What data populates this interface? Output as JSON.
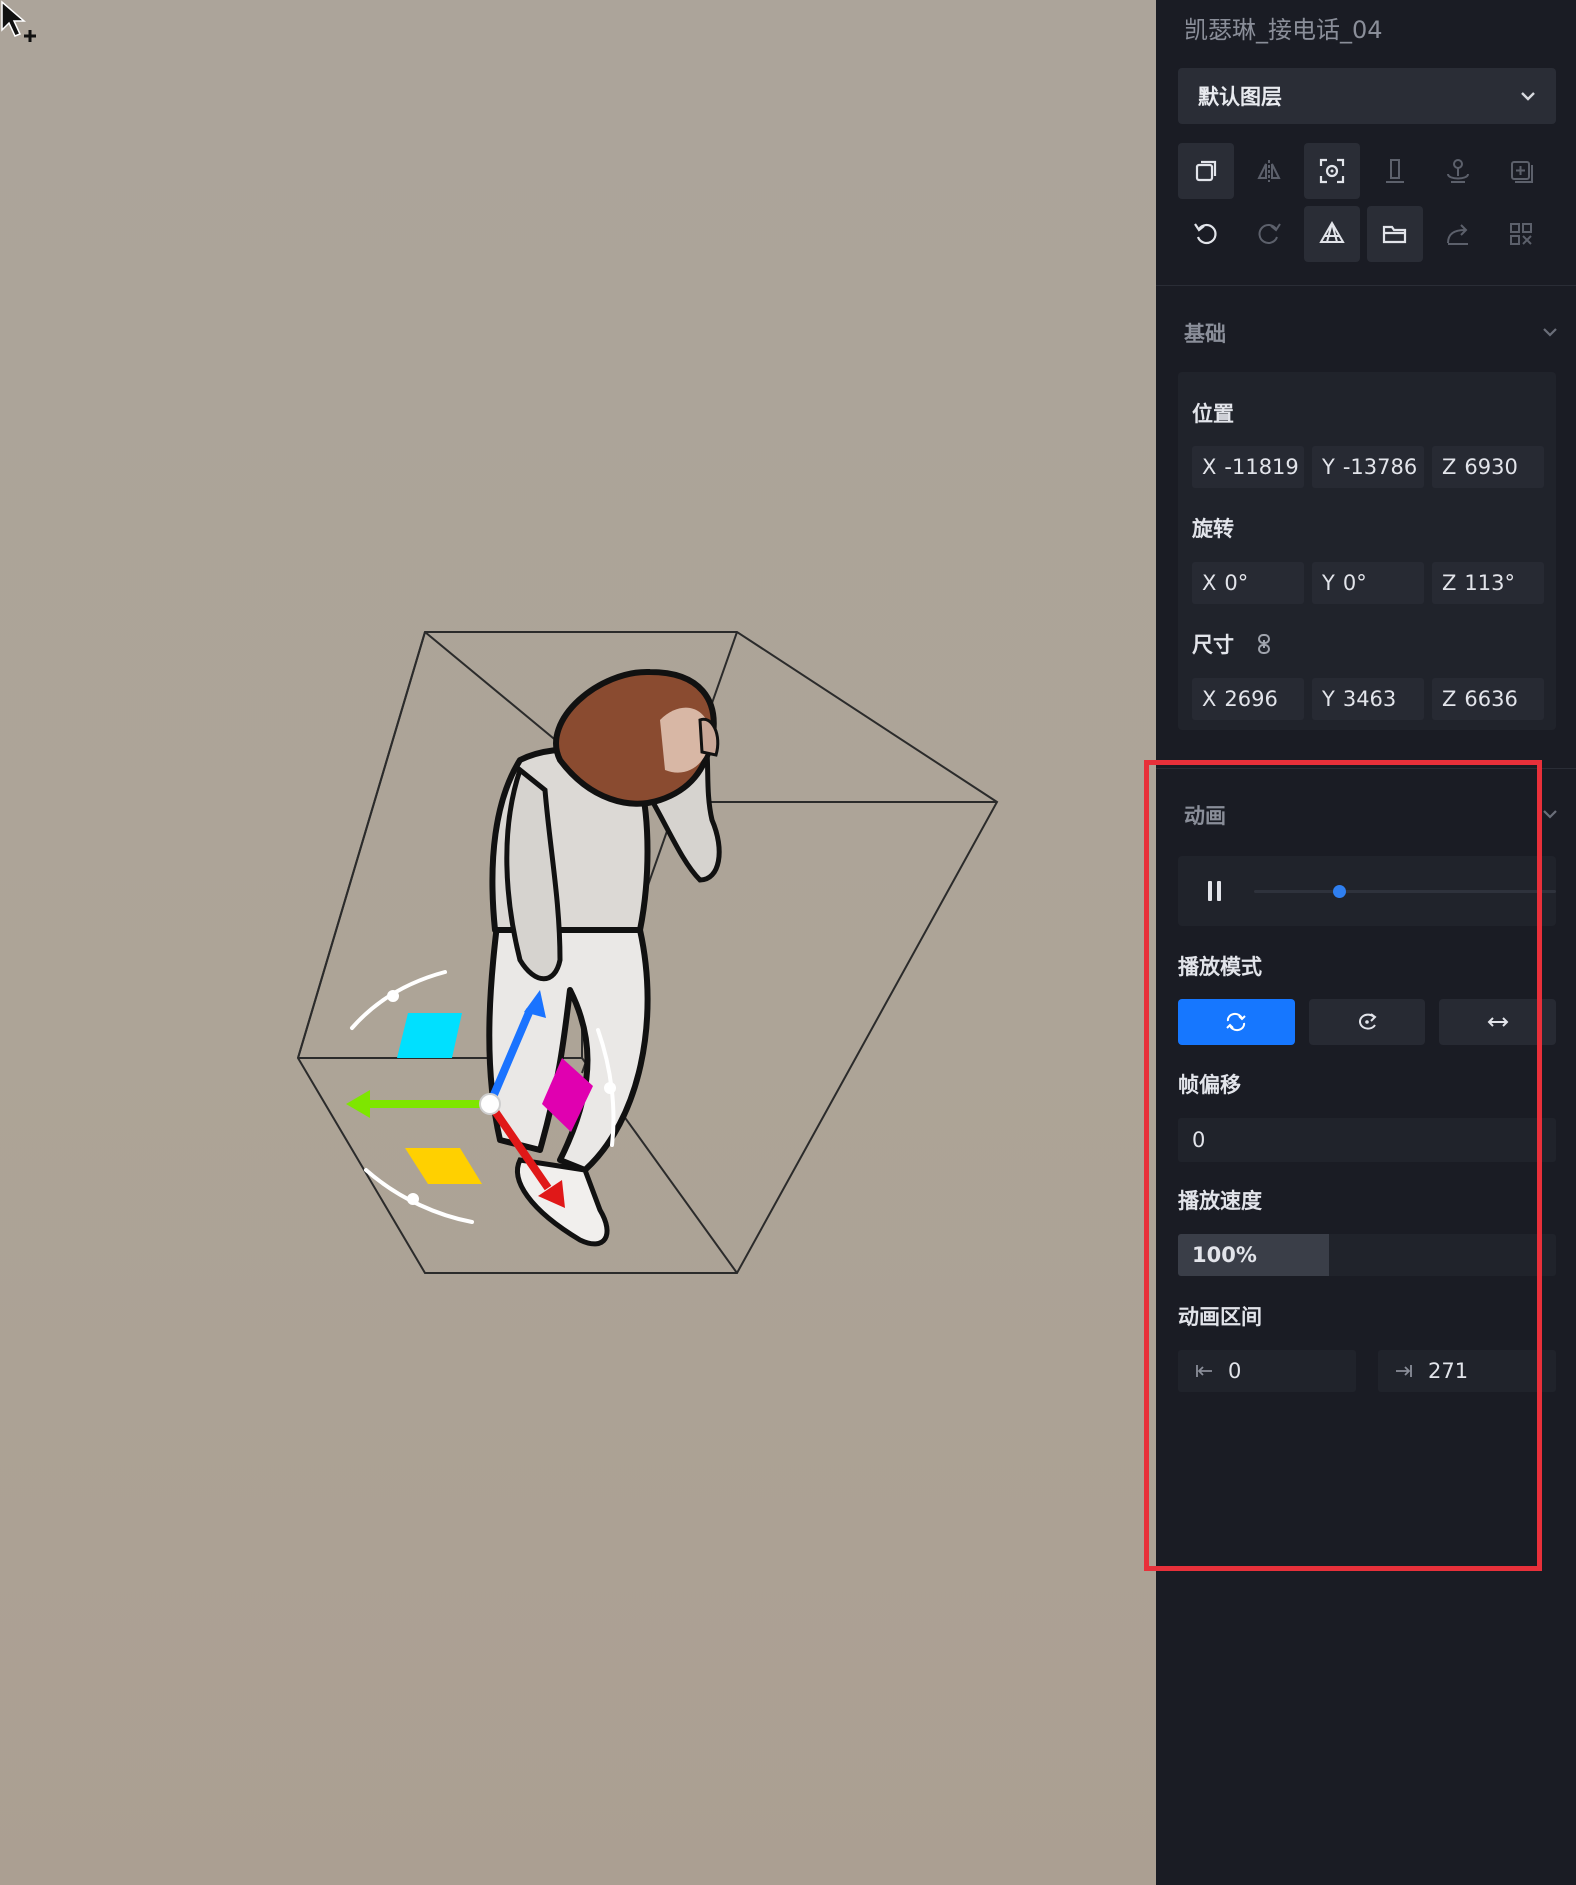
{
  "object_title": "凯瑟琳_接电话_04",
  "layer": {
    "selected": "默认图层"
  },
  "toolbar": {
    "row1": [
      "copy-icon",
      "mirror-icon",
      "focus-icon",
      "align-ground-icon",
      "drop-to-ground-icon",
      "add-icon"
    ],
    "row2": [
      "undo-icon",
      "redo-icon",
      "material-icon",
      "folder-icon",
      "share-icon",
      "group-icon"
    ]
  },
  "basic": {
    "title": "基础",
    "position": {
      "label": "位置",
      "x": "-11819",
      "y": "-13786",
      "z": "6930"
    },
    "rotation": {
      "label": "旋转",
      "x": "0°",
      "y": "0°",
      "z": "113°"
    },
    "size": {
      "label": "尺寸",
      "x": "2696",
      "y": "3463",
      "z": "6636"
    },
    "axis": {
      "x": "X",
      "y": "Y",
      "z": "Z"
    }
  },
  "animation": {
    "title": "动画",
    "progress": 0.28,
    "play_mode_label": "播放模式",
    "play_modes": [
      "loop",
      "once",
      "ping-pong"
    ],
    "active_mode": 0,
    "frame_offset_label": "帧偏移",
    "frame_offset": "0",
    "speed_label": "播放速度",
    "speed": "100%",
    "speed_fraction": 0.4,
    "range_label": "动画区间",
    "range_start": "0",
    "range_end": "271"
  },
  "colors": {
    "panel_bg": "#1a1c24",
    "accent": "#1677ff",
    "highlight": "#e8303a",
    "viewport_bg": "#aca49a"
  }
}
